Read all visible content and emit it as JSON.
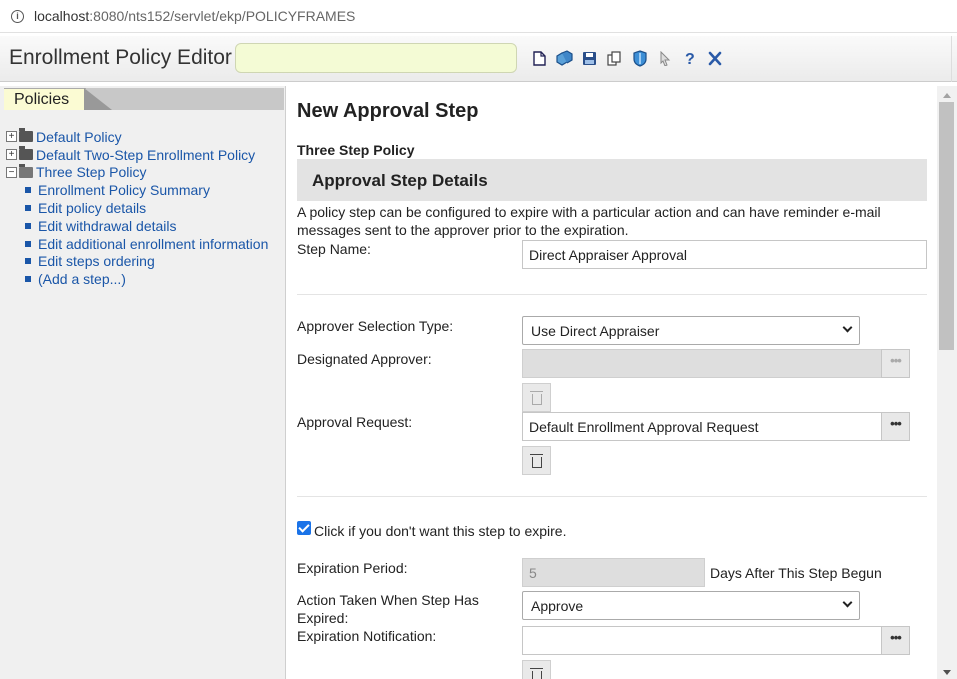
{
  "browser": {
    "url_host": "localhost",
    "url_path": ":8080/nts152/servlet/ekp/POLICYFRAMES"
  },
  "header": {
    "title": "Enrollment Policy Editor",
    "search_value": "",
    "toolbar_icons": [
      "new-page-icon",
      "cubes-icon",
      "save-icon",
      "copy-icon",
      "shield-icon",
      "pointer-icon",
      "help-icon",
      "close-icon"
    ]
  },
  "left_panel": {
    "tab_label": "Policies",
    "tree": [
      {
        "label": "Default Policy",
        "expanded": false
      },
      {
        "label": "Default Two-Step Enrollment Policy",
        "expanded": false
      },
      {
        "label": "Three Step Policy",
        "expanded": true,
        "children": [
          "Enrollment Policy Summary",
          "Edit policy details",
          "Edit withdrawal details",
          "Edit additional enrollment information",
          "Edit steps ordering",
          "(Add a step...)"
        ]
      }
    ]
  },
  "main": {
    "page_title": "New Approval Step",
    "policy_name": "Three Step Policy",
    "section_title": "Approval Step Details",
    "description": "A policy step can be configured to expire with a particular action and can have reminder e-mail messages sent to the approver prior to the expiration.",
    "step_name_label": "Step Name:",
    "step_name_value": "Direct Appraiser Approval",
    "approver_type_label": "Approver Selection Type:",
    "approver_type_value": "Use Direct Appraiser",
    "designated_approver_label": "Designated Approver:",
    "designated_approver_value": "",
    "approval_request_label": "Approval Request:",
    "approval_request_value": "Default Enrollment Approval Request",
    "no_expire_checkbox_label": "Click if you don't want this step to expire.",
    "no_expire_checked": true,
    "expiration_period_label": "Expiration Period:",
    "expiration_period_value": "5",
    "expiration_period_unit": "Days After This Step Begun",
    "action_label": "Action Taken When Step Has Expired:",
    "action_value": "Approve",
    "expiration_notification_label": "Expiration Notification:",
    "expiration_notification_value": "",
    "browse_button_label": "•••"
  }
}
